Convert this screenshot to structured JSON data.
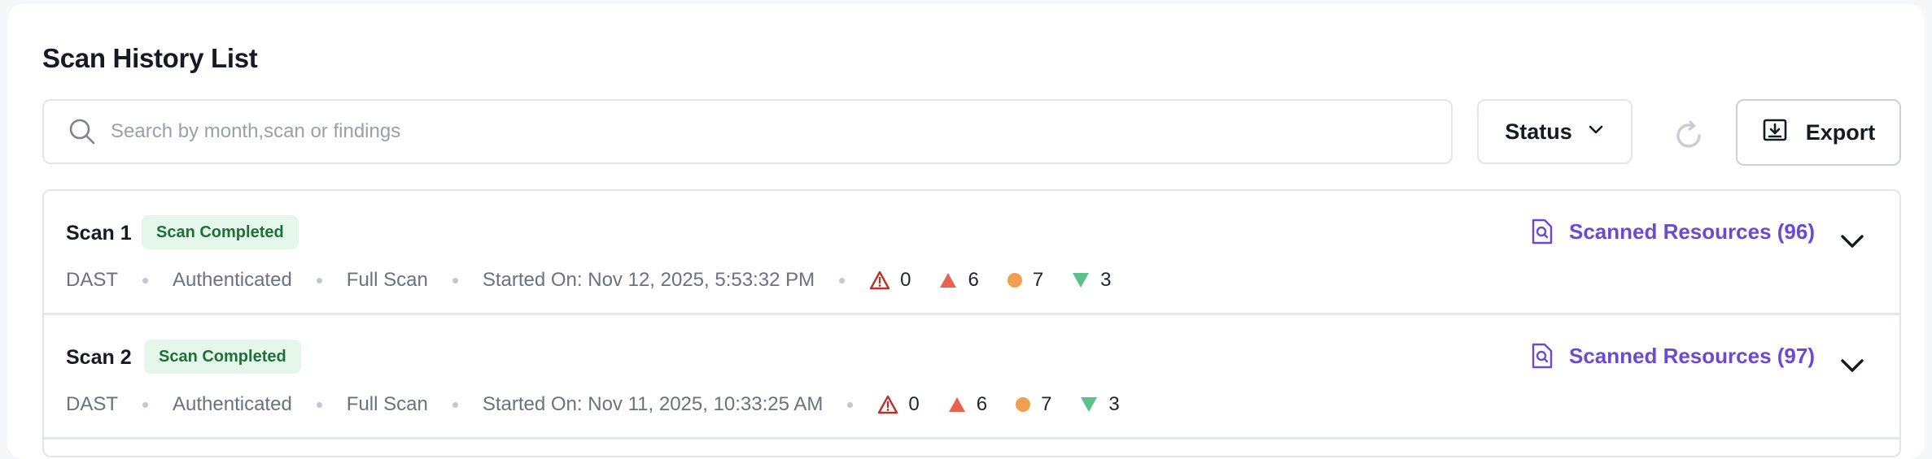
{
  "page": {
    "title": "Scan History List"
  },
  "search": {
    "placeholder": "Search by month,scan or findings",
    "value": ""
  },
  "toolbar": {
    "status_label": "Status",
    "export_label": "Export"
  },
  "scans": [
    {
      "name": "Scan 1",
      "status": "Scan Completed",
      "type": "DAST",
      "auth": "Authenticated",
      "mode": "Full Scan",
      "started": "Started On: Nov 12, 2025, 5:53:32 PM",
      "critical": "0",
      "high": "6",
      "medium": "7",
      "low": "3",
      "resources": "Scanned Resources (96)"
    },
    {
      "name": "Scan 2",
      "status": "Scan Completed",
      "type": "DAST",
      "auth": "Authenticated",
      "mode": "Full Scan",
      "started": "Started On: Nov 11, 2025, 10:33:25 AM",
      "critical": "0",
      "high": "6",
      "medium": "7",
      "low": "3",
      "resources": "Scanned Resources (97)"
    }
  ],
  "colors": {
    "accent": "#6a4ad0",
    "critical": "#b8322a",
    "high": "#e8634f",
    "medium": "#f0a050",
    "low": "#5cc08a",
    "badge_bg": "#e5f7ea",
    "badge_text": "#1f6f3a"
  },
  "icons": {
    "search": "search-icon",
    "status_dropdown": "chevron-down-icon",
    "refresh": "refresh-icon",
    "export": "export-icon",
    "critical": "warning-triangle-outline-icon",
    "high": "triangle-up-icon",
    "medium": "circle-icon",
    "low": "triangle-down-icon",
    "resources": "document-search-icon",
    "expand": "chevron-down-icon"
  }
}
